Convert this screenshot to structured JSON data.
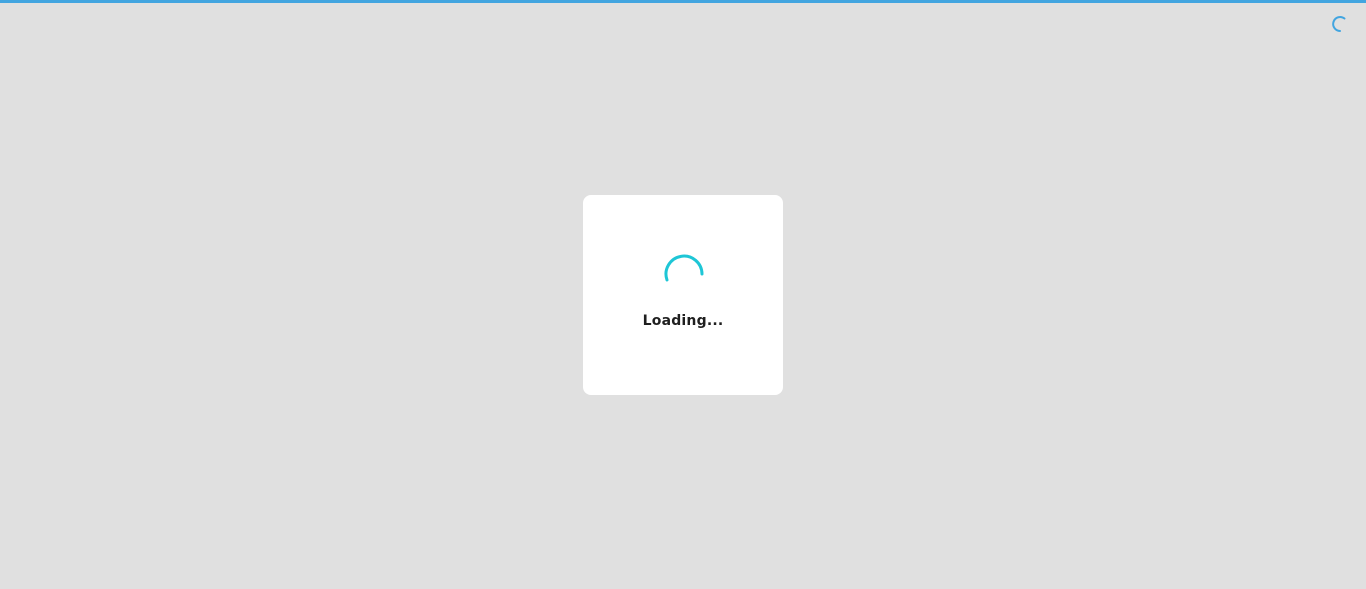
{
  "loading": {
    "label": "Loading...",
    "spinner_icon": "spinner-icon",
    "spinner_color": "#1ec6d6"
  },
  "top_bar": {
    "progress_color": "#42a5e0",
    "progress": 1.0,
    "spinner_icon": "spinner-icon",
    "spinner_color": "#42a5e0"
  },
  "background_color": "#e0e0e0"
}
